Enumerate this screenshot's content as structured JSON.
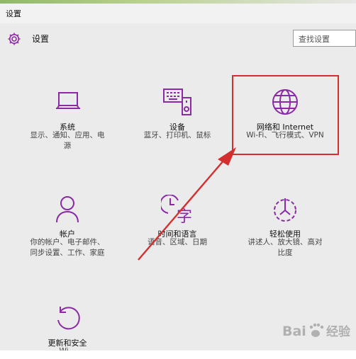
{
  "window": {
    "title": "设置"
  },
  "header": {
    "title": "设置",
    "icon": "gear-icon"
  },
  "search": {
    "placeholder": "查找设置"
  },
  "accent": "#8b2aa6",
  "highlight_color": "#d32f2f",
  "tiles": [
    {
      "name": "系统",
      "desc_lines": [
        "显示、通知、应用、电",
        "源"
      ],
      "icon": "laptop-icon"
    },
    {
      "name": "设备",
      "desc_lines": [
        "蓝牙、打印机、鼠标"
      ],
      "icon": "devices-icon"
    },
    {
      "name": "网络和 Internet",
      "desc_lines": [
        "Wi-Fi、飞行模式、VPN"
      ],
      "icon": "globe-icon"
    },
    {
      "name": "帐户",
      "desc_lines": [
        "你的帐户、电子邮件、",
        "同步设置、工作、家庭"
      ],
      "icon": "person-icon"
    },
    {
      "name": "时间和语言",
      "desc_lines": [
        "语音、区域、日期"
      ],
      "icon": "time-language-icon"
    },
    {
      "name": "轻松使用",
      "desc_lines": [
        "讲述人、放大镜、高对",
        "比度"
      ],
      "icon": "ease-of-access-icon"
    },
    {
      "name": "更新和安全",
      "desc_lines": [
        "Wi..."
      ],
      "icon": "refresh-icon"
    }
  ],
  "watermark": {
    "text": "Baiↆ经验"
  }
}
